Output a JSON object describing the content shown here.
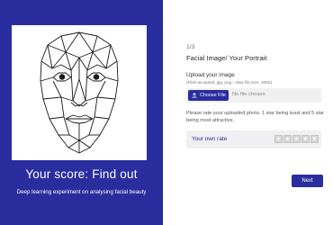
{
  "left_panel": {
    "portrait_icon": "geometric-face-portrait",
    "score_title": "Your score: Find out",
    "score_subtitle": "Deep learning experiment on analysing facial beauty"
  },
  "form": {
    "step": "1/3",
    "heading": "Facial Image/ Your Portrait",
    "upload_label": "Upload your image",
    "upload_hint": "(Files accepted: jpg, png – Max file size: 20Kb)",
    "choose_button_label": "Choose File",
    "upload_icon": "upload-icon",
    "no_file_text": "No file chosen",
    "instructions": "Please rate your uploaded photo. 1 star being least and 5 star being most attractive.",
    "rate_label": "Your own rate",
    "stars": [
      "★",
      "★",
      "★",
      "★",
      "★"
    ],
    "rating_value": 0,
    "next_button_label": "Next"
  },
  "colors": {
    "primary": "#2a2d9e",
    "background": "#ffffff",
    "field_background": "#f0f0f2"
  }
}
